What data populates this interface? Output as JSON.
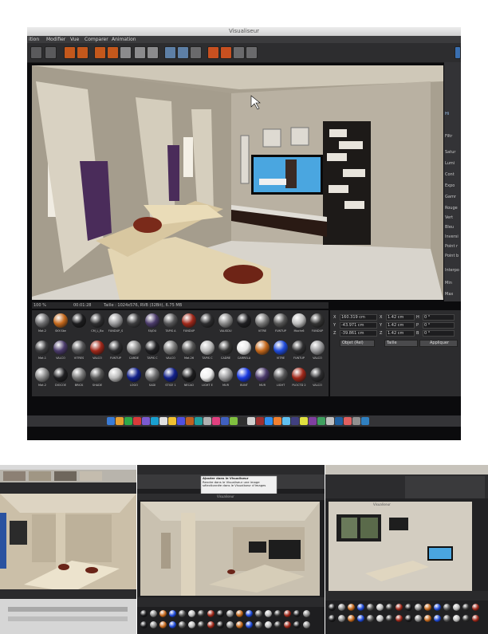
{
  "top_screenshot": {
    "window_title": "Visualiseur",
    "menu": [
      "ition",
      "Modifier",
      "Vue",
      "Comparer",
      "Animation"
    ],
    "status": {
      "zoom": "100 %",
      "time": "00:01:28",
      "size_info": "Taille : 1024x576, RVB (32Bit), 6.75 MB"
    },
    "right_panel_labels": [
      "Hi",
      "Filtr",
      "Satur",
      "Lumi",
      "Cont",
      "Expo",
      "Gamr",
      "Rouge",
      "Vert",
      "Bleu",
      "Inversi",
      "Point r",
      "Point b",
      "Interpo",
      "Min",
      "Max"
    ],
    "materials": {
      "row1": [
        "Mat.2",
        "SKY-Ske",
        "",
        "CM_L_Bo",
        "FUNDUP_S",
        "",
        "FAJOU",
        "TAPIS A",
        "FUNDUP",
        "",
        "VALISDU",
        "",
        "VITRE",
        "FUNTUP",
        "Mochr6",
        "FUNDUP"
      ],
      "row2": [
        "Mat.1",
        "VALCO",
        "VITRES",
        "VALCO",
        "FUNTUP",
        "CARDE",
        "TAPIS C",
        "VALCO",
        "Mat.26",
        "TAPIS C",
        "CADRE",
        "CARRELA",
        "",
        "VITRE",
        "FUNTUP",
        "VALCO"
      ],
      "row3": [
        "Mat.2",
        "DIOCOE",
        "BRICK",
        "SHADE",
        "",
        "LOGO",
        "SADI",
        "STICE 1",
        "NECAO",
        "LIGHT E",
        "MUR",
        "BUNT",
        "MUR",
        "LIGHT",
        "PLOCTD 2",
        "VALCO"
      ]
    },
    "coordinates": {
      "rows": [
        {
          "axis": "X",
          "position": "160.319 cm",
          "size_axis": "X",
          "size": "1.42 cm",
          "rot_axis": "H",
          "rot": "0 °"
        },
        {
          "axis": "Y",
          "position": "-43.971 cm",
          "size_axis": "Y",
          "size": "1.42 cm",
          "rot_axis": "P",
          "rot": "0 °"
        },
        {
          "axis": "Z",
          "position": "-39.861 cm",
          "size_axis": "Z",
          "size": "1.42 cm",
          "rot_axis": "B",
          "rot": "0 °"
        }
      ],
      "mode_select": "Objet (Rel)",
      "size_select": "Taille",
      "apply_button": "Appliquer"
    }
  },
  "bottom_mid": {
    "window_title": "Visualiseur",
    "tooltip_title": "Ajouter dans le Visualiseur",
    "tooltip_text": "Rendre dans le Visualiseur une image sélectionnée dans le Visualiseur d'images"
  },
  "bottom_right": {
    "window_title": "Visualiseur"
  },
  "colors": {
    "app_dark": "#2d2d2f",
    "wall_beige": "#c9bfae",
    "sofa_cream": "#e3d5b2",
    "pillow_red": "#7a2a1a",
    "tv_screen": "#4aa6e0"
  }
}
